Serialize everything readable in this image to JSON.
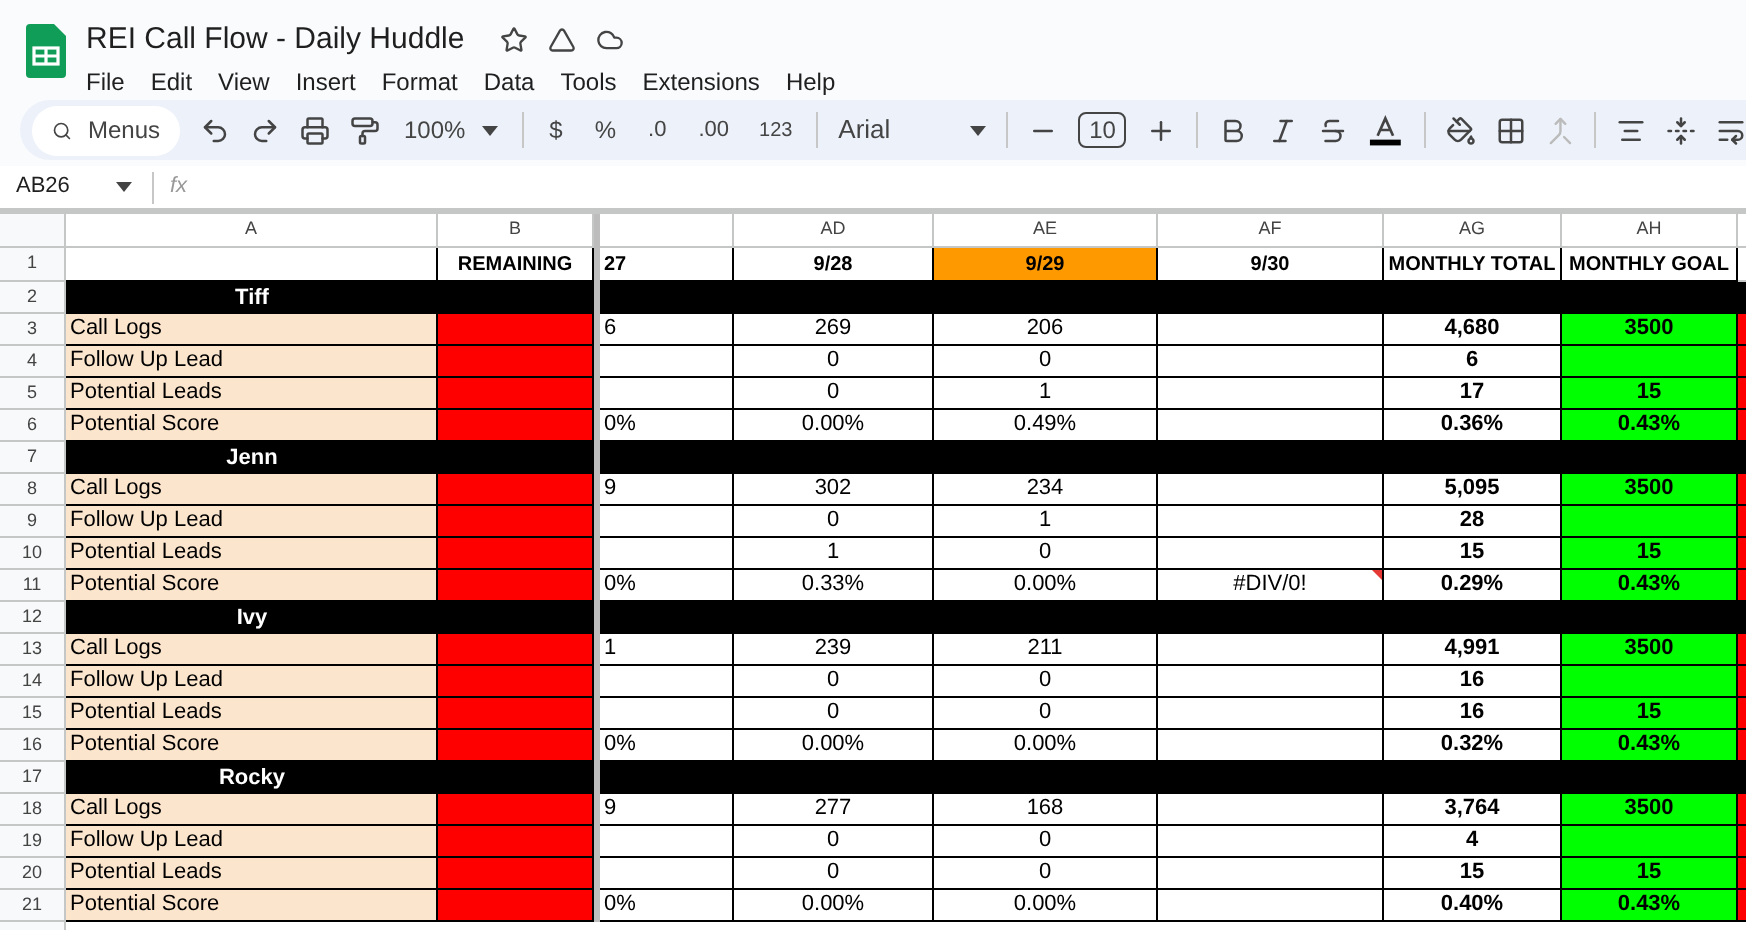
{
  "window": {
    "title": "REI Call Flow - Daily Huddle"
  },
  "menu": [
    "File",
    "Edit",
    "View",
    "Insert",
    "Format",
    "Data",
    "Tools",
    "Extensions",
    "Help"
  ],
  "toolbar": {
    "search": "Menus",
    "zoom": "100%",
    "currency": "$",
    "percent": "%",
    "decrease_decimal": ".0",
    "increase_decimal": ".00",
    "number_format": "123",
    "font": "Arial",
    "font_size": "10"
  },
  "formula_bar": {
    "cell": "AB26",
    "function_label": "fx"
  },
  "sheet": {
    "columns": [
      {
        "label": "A",
        "color": "#fce5cd"
      },
      {
        "label": "B",
        "color": "#ff0000"
      },
      {
        "cut": true
      },
      {
        "label": "AD"
      },
      {
        "label": "AE"
      },
      {
        "label": "AF"
      },
      {
        "label": "AG"
      },
      {
        "label": "AH",
        "color": "#00ff00"
      }
    ],
    "rows": [
      {
        "number": "1",
        "kind": "header",
        "cells": [
          {
            "text": ""
          },
          {
            "text": "REMAINING"
          },
          {
            "text": "27"
          },
          {
            "text": "9/28"
          },
          {
            "text": "9/29",
            "color": "#ff9900"
          },
          {
            "text": "9/30"
          },
          {
            "text": "MONTHLY TOTAL"
          },
          {
            "text": "MONTHLY GOAL"
          }
        ]
      },
      {
        "number": "2",
        "kind": "section",
        "name": "Tiff"
      },
      {
        "number": "3",
        "kind": "metric",
        "cells": [
          "Call Logs",
          "",
          "6",
          "269",
          "206",
          "",
          "4,680",
          "3500"
        ]
      },
      {
        "number": "4",
        "kind": "metric",
        "cells": [
          "Follow Up Lead",
          "",
          "",
          "0",
          "0",
          "",
          "6",
          ""
        ]
      },
      {
        "number": "5",
        "kind": "metric",
        "cells": [
          "Potential Leads",
          "",
          "",
          "0",
          "1",
          "",
          "17",
          "15"
        ]
      },
      {
        "number": "6",
        "kind": "metric",
        "cells": [
          "Potential Score",
          "",
          "0%",
          "0.00%",
          "0.49%",
          "",
          "0.36%",
          "0.43%"
        ]
      },
      {
        "number": "7",
        "kind": "section",
        "name": "Jenn"
      },
      {
        "number": "8",
        "kind": "metric",
        "cells": [
          "Call Logs",
          "",
          "9",
          "302",
          "234",
          "",
          "5,095",
          "3500"
        ]
      },
      {
        "number": "9",
        "kind": "metric",
        "cells": [
          "Follow Up Lead",
          "",
          "",
          "0",
          "1",
          "",
          "28",
          ""
        ]
      },
      {
        "number": "10",
        "kind": "metric",
        "cells": [
          "Potential Leads",
          "",
          "",
          "1",
          "0",
          "",
          "15",
          "15"
        ]
      },
      {
        "number": "11",
        "kind": "metric",
        "cells": [
          "Potential Score",
          "",
          "0%",
          "0.33%",
          "0.00%",
          {
            "text": "#DIV/0!",
            "error": true
          },
          "0.29%",
          "0.43%"
        ]
      },
      {
        "number": "12",
        "kind": "section",
        "name": "Ivy"
      },
      {
        "number": "13",
        "kind": "metric",
        "cells": [
          "Call Logs",
          "",
          "1",
          "239",
          "211",
          "",
          "4,991",
          "3500"
        ]
      },
      {
        "number": "14",
        "kind": "metric",
        "cells": [
          "Follow Up Lead",
          "",
          "",
          "0",
          "0",
          "",
          "16",
          ""
        ]
      },
      {
        "number": "15",
        "kind": "metric",
        "cells": [
          "Potential Leads",
          "",
          "",
          "0",
          "0",
          "",
          "16",
          "15"
        ]
      },
      {
        "number": "16",
        "kind": "metric",
        "cells": [
          "Potential Score",
          "",
          "0%",
          "0.00%",
          "0.00%",
          "",
          "0.32%",
          "0.43%"
        ]
      },
      {
        "number": "17",
        "kind": "section",
        "name": "Rocky"
      },
      {
        "number": "18",
        "kind": "metric",
        "cells": [
          "Call Logs",
          "",
          "9",
          "277",
          "168",
          "",
          "3,764",
          "3500"
        ]
      },
      {
        "number": "19",
        "kind": "metric",
        "cells": [
          "Follow Up Lead",
          "",
          "",
          "0",
          "0",
          "",
          "4",
          ""
        ]
      },
      {
        "number": "20",
        "kind": "metric",
        "cells": [
          "Potential Leads",
          "",
          "",
          "0",
          "0",
          "",
          "15",
          "15"
        ]
      },
      {
        "number": "21",
        "kind": "metric",
        "cells": [
          "Potential Score",
          "",
          "0%",
          "0.00%",
          "0.00%",
          "",
          "0.40%",
          "0.43%"
        ]
      }
    ]
  }
}
